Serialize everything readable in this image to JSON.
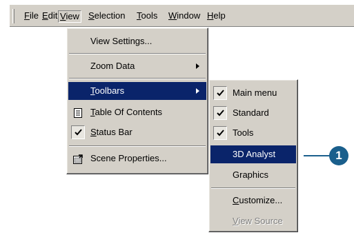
{
  "menubar": {
    "items": [
      {
        "key": "F",
        "rest": "ile"
      },
      {
        "key": "E",
        "rest": "dit"
      },
      {
        "key": "V",
        "rest": "iew"
      },
      {
        "key": "S",
        "rest": "election"
      },
      {
        "key": "T",
        "rest": "ools"
      },
      {
        "key": "W",
        "rest": "indow"
      },
      {
        "key": "H",
        "rest": "elp"
      }
    ]
  },
  "view_menu": {
    "view_settings": "View Settings...",
    "zoom_data": "Zoom Data",
    "toolbars": {
      "key": "T",
      "rest": "oolbars"
    },
    "table_of_contents": {
      "key": "T",
      "rest": "able Of Contents"
    },
    "status_bar": {
      "key": "S",
      "rest": "tatus Bar"
    },
    "scene_properties": "Scene Properties..."
  },
  "toolbars_menu": {
    "main_menu": "Main menu",
    "standard": "Standard",
    "tools": "Tools",
    "analyst_3d": "3D Analyst",
    "graphics": "Graphics",
    "customize": {
      "key": "C",
      "rest": "ustomize..."
    },
    "view_source": {
      "key": "V",
      "rest": "iew Source"
    }
  },
  "callout": {
    "number": "1"
  },
  "colors": {
    "selection": "#0a246a",
    "menu_bg": "#d4d0c8",
    "callout": "#1a5f8c"
  }
}
